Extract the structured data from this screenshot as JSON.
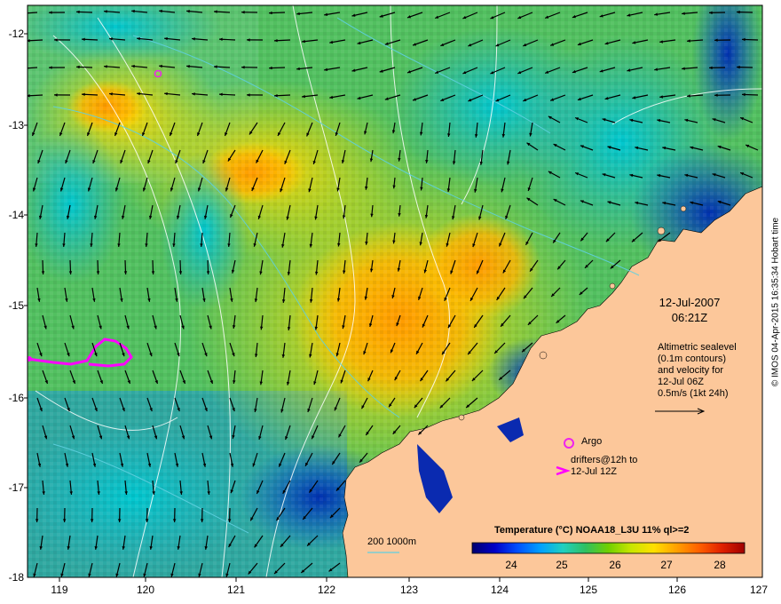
{
  "x_ticks": [
    "119",
    "120",
    "121",
    "122",
    "123",
    "124",
    "125",
    "126",
    "127"
  ],
  "y_ticks": [
    "-12",
    "-13",
    "-14",
    "-15",
    "-16",
    "-17",
    "-18"
  ],
  "annotation": {
    "date": "12-Jul-2007",
    "time": "06:21Z",
    "alt_1": "Altimetric sealevel",
    "alt_2": "(0.1m contours)",
    "alt_3": "and velocity for",
    "alt_4": "12-Jul 06Z",
    "alt_5": "0.5m/s (1kt 24h)"
  },
  "legend": {
    "argo": "Argo",
    "drifters_1": "drifters@12h to",
    "drifters_2": "12-Jul 12Z"
  },
  "depth_legend": {
    "label": "200  1000m"
  },
  "colorbar": {
    "title": "Temperature (°C) NOAA18_L3U 11% ql>=2",
    "ticks": [
      "24",
      "25",
      "26",
      "27",
      "28"
    ],
    "colors": [
      "#00006e",
      "#0000c8",
      "#0050ff",
      "#00a0ff",
      "#20d0c0",
      "#30c060",
      "#70d000",
      "#c8e600",
      "#ffe000",
      "#ffa000",
      "#ff6000",
      "#e02000",
      "#a00000"
    ]
  },
  "credit": "© IMOS 04-Apr-2015 16:35:34 Hobart time",
  "colors": {
    "land": "#fcc79a",
    "argo_marker": "#ee22ee",
    "drifter_track": "#ff00ff",
    "contour": "#ffffff",
    "isobath": "#5fd0e0"
  }
}
